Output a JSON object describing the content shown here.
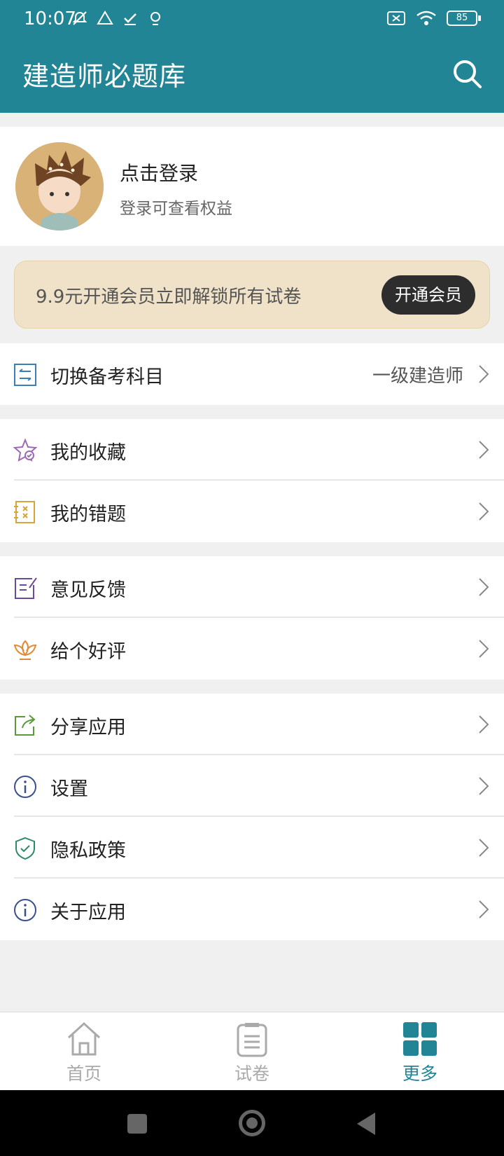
{
  "status_bar": {
    "time": "10:07",
    "battery": "85"
  },
  "header": {
    "title": "建造师必题库"
  },
  "profile": {
    "name": "点击登录",
    "subtitle": "登录可查看权益"
  },
  "vip_banner": {
    "text": "9.9元开通会员立即解锁所有试卷",
    "button": "开通会员"
  },
  "subject": {
    "label": "切换备考科目",
    "value": "一级建造师"
  },
  "menu_group_1": [
    {
      "label": "我的收藏"
    },
    {
      "label": "我的错题"
    }
  ],
  "menu_group_2": [
    {
      "label": "意见反馈"
    },
    {
      "label": "给个好评"
    }
  ],
  "menu_group_3": [
    {
      "label": "分享应用"
    },
    {
      "label": "设置"
    },
    {
      "label": "隐私政策"
    },
    {
      "label": "关于应用"
    }
  ],
  "tabs": [
    {
      "label": "首页"
    },
    {
      "label": "试卷"
    },
    {
      "label": "更多"
    }
  ],
  "colors": {
    "primary": "#228595",
    "vip_bg": "#f0e2c8"
  }
}
